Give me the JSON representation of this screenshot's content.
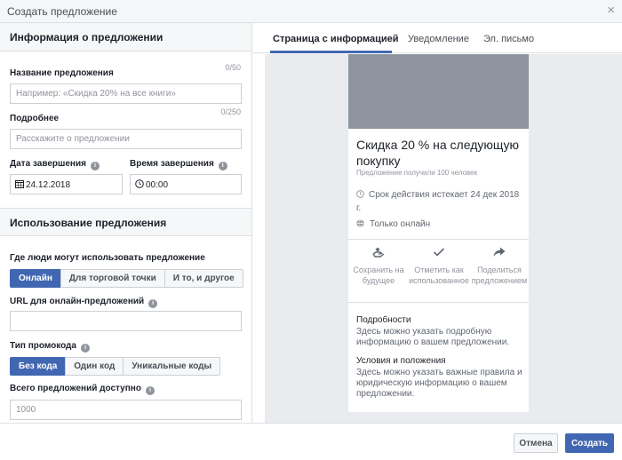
{
  "dialog": {
    "title": "Создать предложение",
    "close_icon": "×"
  },
  "info_section": {
    "heading": "Информация о предложении",
    "name_label": "Название предложения",
    "name_counter": "0/50",
    "name_placeholder": "Например: «Скидка 20% на все книги»",
    "details_label": "Подробнее",
    "details_counter": "0/250",
    "details_placeholder": "Расскажите о предложении",
    "end_date_label": "Дата завершения",
    "end_date_value": "24.12.2018",
    "end_time_label": "Время завершения",
    "end_time_value": "00:00"
  },
  "usage_section": {
    "heading": "Использование предложения",
    "where_label": "Где люди могут использовать предложение",
    "where_options": [
      "Онлайн",
      "Для торговой точки",
      "И то, и другое"
    ],
    "url_label": "URL для онлайн-предложений",
    "promo_label": "Тип промокода",
    "promo_options": [
      "Без кода",
      "Один код",
      "Уникальные коды"
    ],
    "total_label": "Всего предложений доступно",
    "total_placeholder": "1000"
  },
  "tabs": [
    "Страница с информацией",
    "Уведомление",
    "Эл. письмо"
  ],
  "preview": {
    "title": "Скидка 20 % на следующую покупку",
    "claimed": "Предложение получили 100 человек",
    "expire": "Срок действия истекает 24 дек 2018 г.",
    "online": "Только онлайн",
    "actions": {
      "save": "Сохранить на будущее",
      "mark": "Отметить как использованное",
      "share": "Поделиться предложением"
    },
    "details_title": "Подробности",
    "details_body": "Здесь можно указать подробную информацию о вашем предложении.",
    "terms_title": "Условия и положения",
    "terms_body": "Здесь можно указать важные правила и юридическую информацию о вашем предложении."
  },
  "footer": {
    "cancel": "Отмена",
    "create": "Создать"
  },
  "colors": {
    "accent": "#4267b2",
    "cover": "#8d949e",
    "preview_bg": "#e9ebee"
  }
}
